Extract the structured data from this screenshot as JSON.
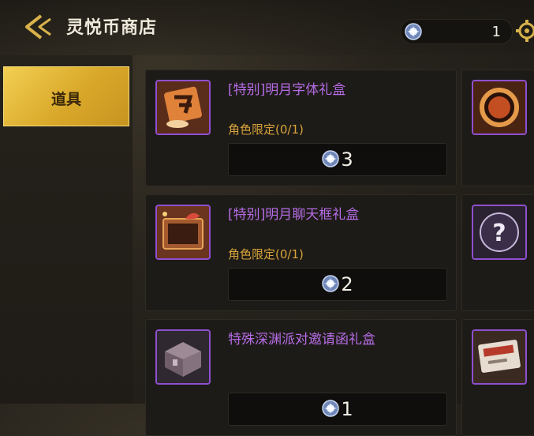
{
  "header": {
    "title": "灵悦币商店",
    "currency_amount": "1"
  },
  "sidebar": {
    "tabs": [
      {
        "label": "道具",
        "active": true
      }
    ]
  },
  "items": [
    {
      "name": "[特别]明月字体礼盒",
      "limit_label": "角色限定",
      "limit_count": "(0/1)",
      "price": "3",
      "icon": "font-box-icon"
    },
    {
      "name": "[特别]明月聊天框礼盒",
      "limit_label": "角色限定",
      "limit_count": "(0/1)",
      "price": "2",
      "icon": "chat-frame-box-icon"
    },
    {
      "name": "特殊深渊派对邀请函礼盒",
      "limit_label": "",
      "limit_count": "",
      "price": "1",
      "icon": "treasure-chest-icon"
    }
  ],
  "right_column_icons": [
    "ring-frame-icon",
    "mystery-orb-icon",
    "invitation-card-icon"
  ],
  "colors": {
    "accent_gold": "#e3b63a",
    "item_name_purple": "#b66ce6",
    "limit_orange": "#d8a33a",
    "rare_border": "#8f4fd0"
  }
}
